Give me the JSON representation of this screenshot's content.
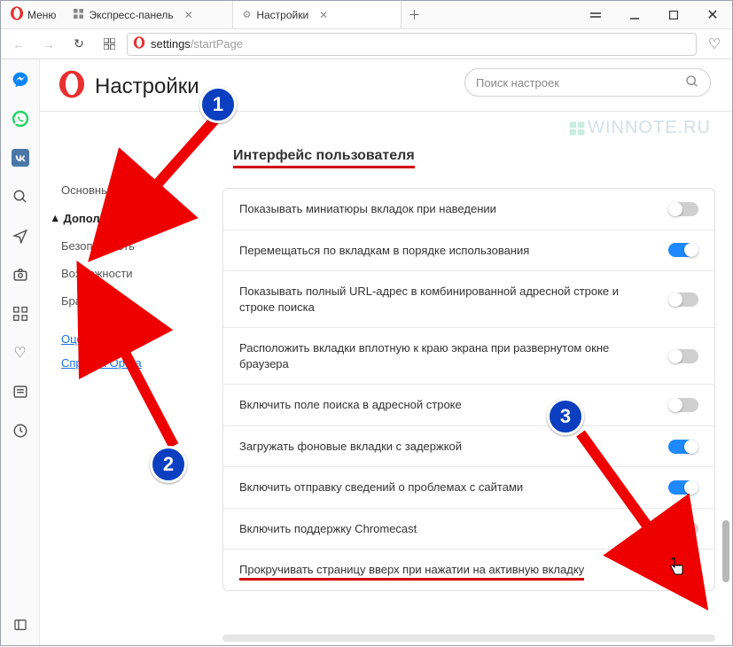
{
  "titlebar": {
    "menu": "Меню",
    "tabs": [
      {
        "label": "Экспресс-панель",
        "icon": "grid"
      },
      {
        "label": "Настройки",
        "icon": "gear"
      }
    ]
  },
  "url": {
    "path": "settings",
    "tail": "/startPage"
  },
  "page": {
    "title": "Настройки",
    "search_placeholder": "Поиск настроек"
  },
  "nav": {
    "basic": "Основные",
    "advanced": "Дополнительно",
    "security": "Безопасность",
    "features": "Возможности",
    "browser": "Браузер",
    "rate": "Оценить Opera",
    "help": "Справка Opera"
  },
  "section": {
    "title": "Интерфейс пользователя",
    "rows": [
      {
        "label": "Показывать миниатюры вкладок при наведении",
        "on": false
      },
      {
        "label": "Перемещаться по вкладкам в порядке использования",
        "on": true
      },
      {
        "label": "Показывать полный URL-адрес в комбинированной адресной строке и строке поиска",
        "on": false
      },
      {
        "label": "Расположить вкладки вплотную к краю экрана при развернутом окне браузера",
        "on": false
      },
      {
        "label": "Включить поле поиска в адресной строке",
        "on": false
      },
      {
        "label": "Загружать фоновые вкладки с задержкой",
        "on": true
      },
      {
        "label": "Включить отправку сведений о проблемах с сайтами",
        "on": true
      },
      {
        "label": "Включить поддержку Chromecast",
        "on": false
      },
      {
        "label": "Прокручивать страницу вверх при нажатии на активную вкладку",
        "on": false
      }
    ]
  },
  "annotations": {
    "b1": "1",
    "b2": "2",
    "b3": "3"
  },
  "watermark": "WINNOTE.RU"
}
